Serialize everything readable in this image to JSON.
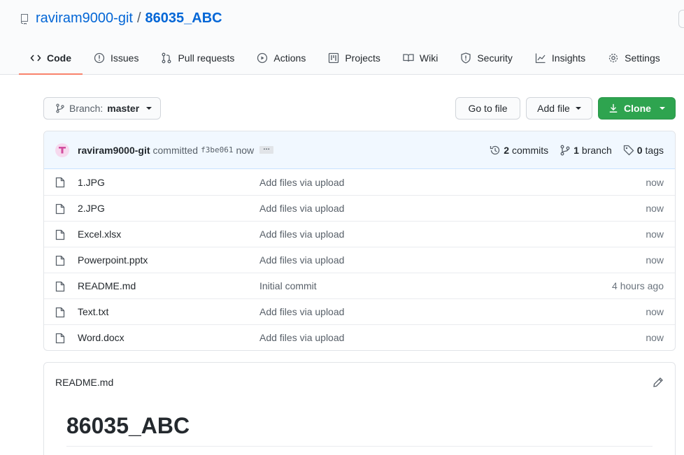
{
  "repo": {
    "owner": "raviram9000-git",
    "separator": "/",
    "name": "86035_ABC"
  },
  "tabs": [
    {
      "label": "Code",
      "icon": "code-icon",
      "active": true
    },
    {
      "label": "Issues",
      "icon": "issue-icon"
    },
    {
      "label": "Pull requests",
      "icon": "pull-request-icon"
    },
    {
      "label": "Actions",
      "icon": "play-icon"
    },
    {
      "label": "Projects",
      "icon": "project-icon"
    },
    {
      "label": "Wiki",
      "icon": "book-icon"
    },
    {
      "label": "Security",
      "icon": "shield-icon"
    },
    {
      "label": "Insights",
      "icon": "graph-icon"
    },
    {
      "label": "Settings",
      "icon": "gear-icon"
    }
  ],
  "toolbar": {
    "branch_prefix": "Branch:",
    "branch_name": "master",
    "goto_file": "Go to file",
    "add_file": "Add file",
    "clone": "Clone"
  },
  "commit": {
    "author": "raviram9000-git",
    "verb": "committed",
    "sha": "f3be061",
    "time": "now",
    "ellipsis": "…",
    "commits_count": "2",
    "commits_label": "commits",
    "branch_count": "1",
    "branch_label": "branch",
    "tags_count": "0",
    "tags_label": "tags"
  },
  "files": [
    {
      "name": "1.JPG",
      "message": "Add files via upload",
      "age": "now"
    },
    {
      "name": "2.JPG",
      "message": "Add files via upload",
      "age": "now"
    },
    {
      "name": "Excel.xlsx",
      "message": "Add files via upload",
      "age": "now"
    },
    {
      "name": "Powerpoint.pptx",
      "message": "Add files via upload",
      "age": "now"
    },
    {
      "name": "README.md",
      "message": "Initial commit",
      "age": "4 hours ago"
    },
    {
      "name": "Text.txt",
      "message": "Add files via upload",
      "age": "now"
    },
    {
      "name": "Word.docx",
      "message": "Add files via upload",
      "age": "now"
    }
  ],
  "readme": {
    "filename": "README.md",
    "heading": "86035_ABC"
  },
  "colors": {
    "accent_blue": "#0366d6",
    "clone_green": "#2ea44f",
    "active_tab_underline": "#f9826c"
  }
}
